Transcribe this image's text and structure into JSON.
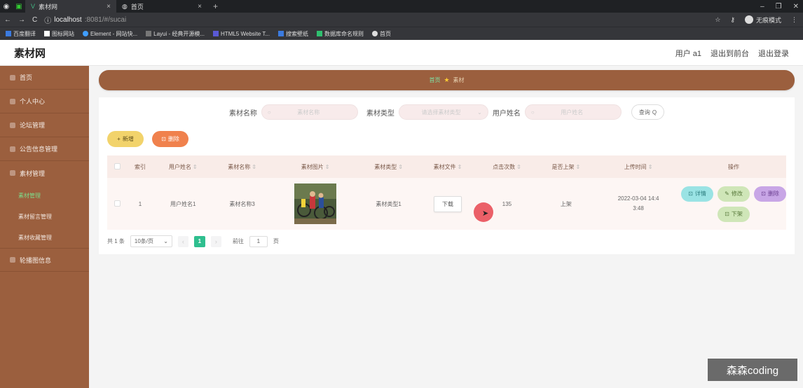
{
  "browser": {
    "tabs": [
      {
        "label": "素材网",
        "active": true
      },
      {
        "label": "首页",
        "active": false
      }
    ],
    "url_host": "localhost",
    "url_path": ":8081/#/sucai",
    "incognito_label": "无痕模式",
    "bookmarks": [
      "百度翻译",
      "图标网站",
      "Element - 网站快...",
      "Layui - 经典开源模...",
      "HTML5 Website T...",
      "搜索壁纸",
      "数据库命名规则",
      "首页"
    ]
  },
  "header": {
    "title": "素材网",
    "user": "用户 a1",
    "to_front": "退出到前台",
    "logout": "退出登录"
  },
  "sidebar": {
    "items": [
      {
        "label": "首页"
      },
      {
        "label": "个人中心"
      },
      {
        "label": "论坛管理"
      },
      {
        "label": "公告信息管理"
      },
      {
        "label": "素材管理"
      }
    ],
    "sub_items": [
      {
        "label": "素材管理",
        "active": true
      },
      {
        "label": "素材留言管理",
        "active": false
      },
      {
        "label": "素材收藏管理",
        "active": false
      }
    ],
    "last_item": "轮播图信息"
  },
  "breadcrumb": {
    "home": "首页",
    "current": "素材"
  },
  "search": {
    "name_label": "素材名称",
    "name_placeholder": "素材名称",
    "type_label": "素材类型",
    "type_placeholder": "请选择素材类型",
    "user_label": "用户姓名",
    "user_placeholder": "用户姓名",
    "query_button": "查询"
  },
  "actions": {
    "add": "新增",
    "delete": "删除"
  },
  "table": {
    "headers": [
      "索引",
      "用户姓名",
      "素材名称",
      "素材图片",
      "素材类型",
      "素材文件",
      "点击次数",
      "是否上架",
      "上传时间",
      "操作"
    ],
    "row": {
      "index": "1",
      "user": "用户姓名1",
      "name": "素材名称3",
      "type": "素材类型1",
      "file_button": "下载",
      "clicks": "135",
      "status": "上架",
      "time_line1": "2022-03-04 14:4",
      "time_line2": "3:48",
      "op_detail": "详情",
      "op_edit": "修改",
      "op_delete": "删除",
      "op_off": "下架"
    }
  },
  "pagination": {
    "total": "共 1 条",
    "page_size": "10条/页",
    "current": "1",
    "goto_label": "前往",
    "goto_value": "1",
    "page_suffix": "页"
  },
  "watermark": "森森coding",
  "colors": {
    "sidebar": "#9b5f3e",
    "active_menu": "#7ddc8a",
    "add_button": "#f2d36b",
    "delete_button": "#f0814d"
  }
}
